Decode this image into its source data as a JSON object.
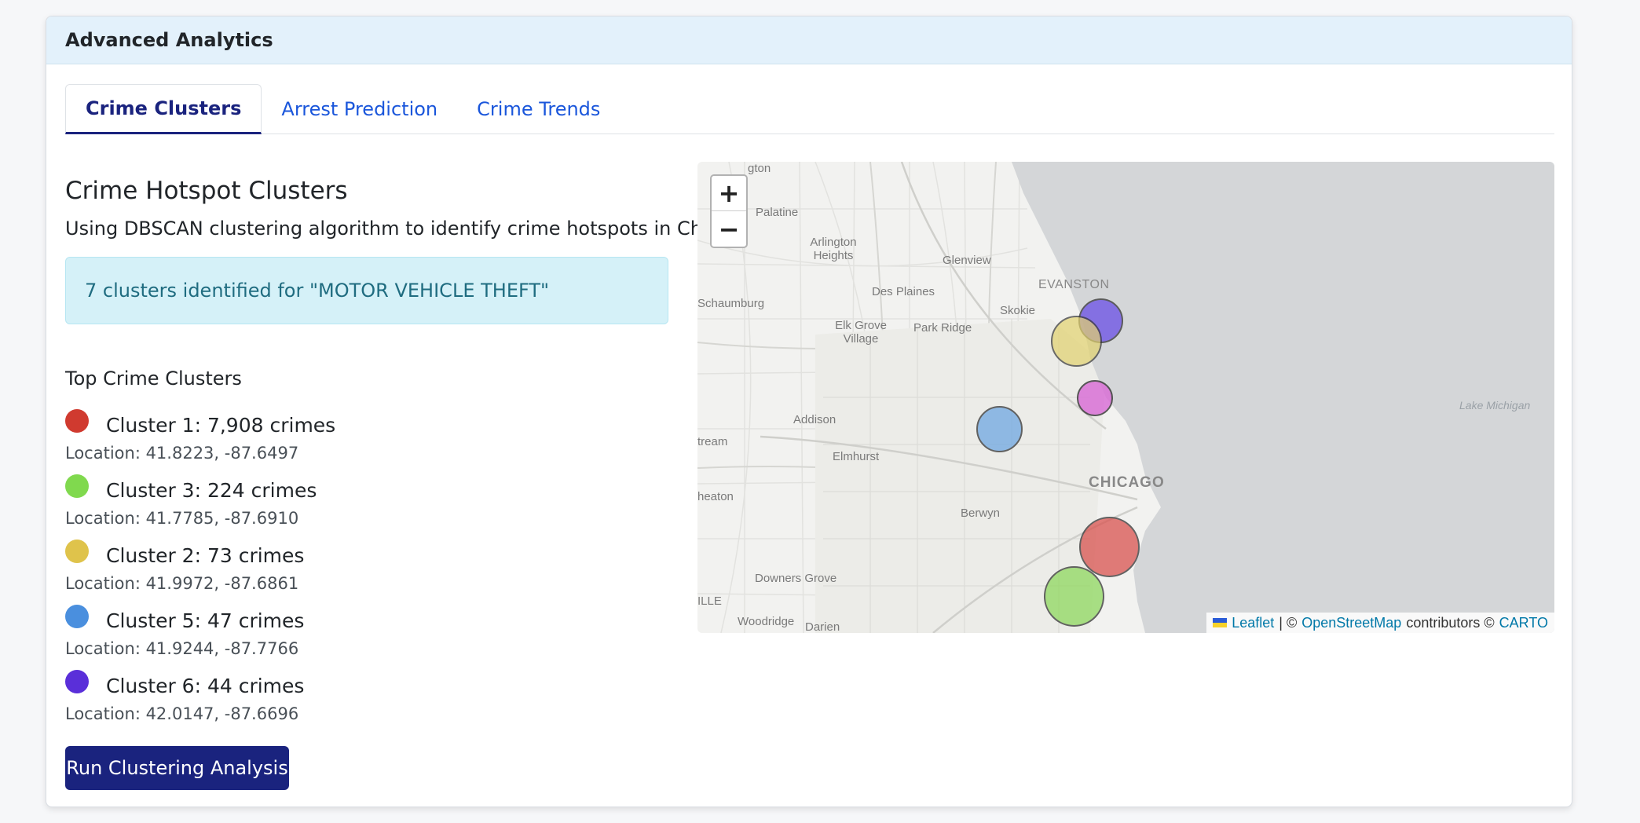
{
  "header": {
    "title": "Advanced Analytics"
  },
  "tabs": [
    {
      "label": "Crime Clusters",
      "active": true
    },
    {
      "label": "Arrest Prediction",
      "active": false
    },
    {
      "label": "Crime Trends",
      "active": false
    }
  ],
  "main": {
    "title": "Crime Hotspot Clusters",
    "description": "Using DBSCAN clustering algorithm to identify crime hotspots in Chicago",
    "alert": "7 clusters identified for \"MOTOR VEHICLE THEFT\"",
    "top_label": "Top Crime Clusters",
    "clusters": [
      {
        "name": "Cluster 1: 7,908 crimes",
        "location": "Location: 41.8223, -87.6497",
        "color": "#d03a2f"
      },
      {
        "name": "Cluster 3: 224 crimes",
        "location": "Location: 41.7785, -87.6910",
        "color": "#80d94e"
      },
      {
        "name": "Cluster 2: 73 crimes",
        "location": "Location: 41.9972, -87.6861",
        "color": "#dfc34b"
      },
      {
        "name": "Cluster 5: 47 crimes",
        "location": "Location: 41.9244, -87.7766",
        "color": "#4a8fde"
      },
      {
        "name": "Cluster 6: 44 crimes",
        "location": "Location: 42.0147, -87.6696",
        "color": "#5a2fd9"
      }
    ],
    "run_button": "Run Clustering Analysis"
  },
  "map": {
    "zoom_in": "+",
    "zoom_out": "−",
    "labels": {
      "palatine": "Palatine",
      "arlington": "Arlington Heights",
      "glenview": "Glenview",
      "evanston": "EVANSTON",
      "des_plaines": "Des Plaines",
      "schaumburg": "Schaumburg",
      "skokie": "Skokie",
      "elk_grove": "Elk Grove Village",
      "park_ridge": "Park Ridge",
      "addison": "Addison",
      "lake_michigan": "Lake Michigan",
      "elmhurst": "Elmhurst",
      "stream": "tream",
      "chicago": "CHICAGO",
      "wheaton": "heaton",
      "berwyn": "Berwyn",
      "downers_grove": "Downers Grove",
      "ille": "ILLE",
      "woodridge": "Woodridge",
      "darien": "Darien",
      "top_cut": "gton"
    },
    "bubbles": [
      {
        "name": "cluster-1-marker",
        "color": "#d9534f",
        "opacity": 0.75
      },
      {
        "name": "cluster-3-marker",
        "color": "#8fd85f",
        "opacity": 0.75
      },
      {
        "name": "cluster-2-marker",
        "color": "#e2d26e",
        "opacity": 0.7
      },
      {
        "name": "cluster-5-marker",
        "color": "#6fa7e2",
        "opacity": 0.75
      },
      {
        "name": "cluster-6-marker",
        "color": "#6a4fe6",
        "opacity": 0.75
      },
      {
        "name": "cluster-4-marker",
        "color": "#d96ad6",
        "opacity": 0.8
      }
    ],
    "attribution": {
      "leaflet": "Leaflet",
      "sep": "| ©",
      "osm": "OpenStreetMap",
      "contributors": "contributors ©",
      "carto": "CARTO"
    },
    "flag_colors": [
      "#2a5bd7",
      "#f7d12a"
    ]
  }
}
